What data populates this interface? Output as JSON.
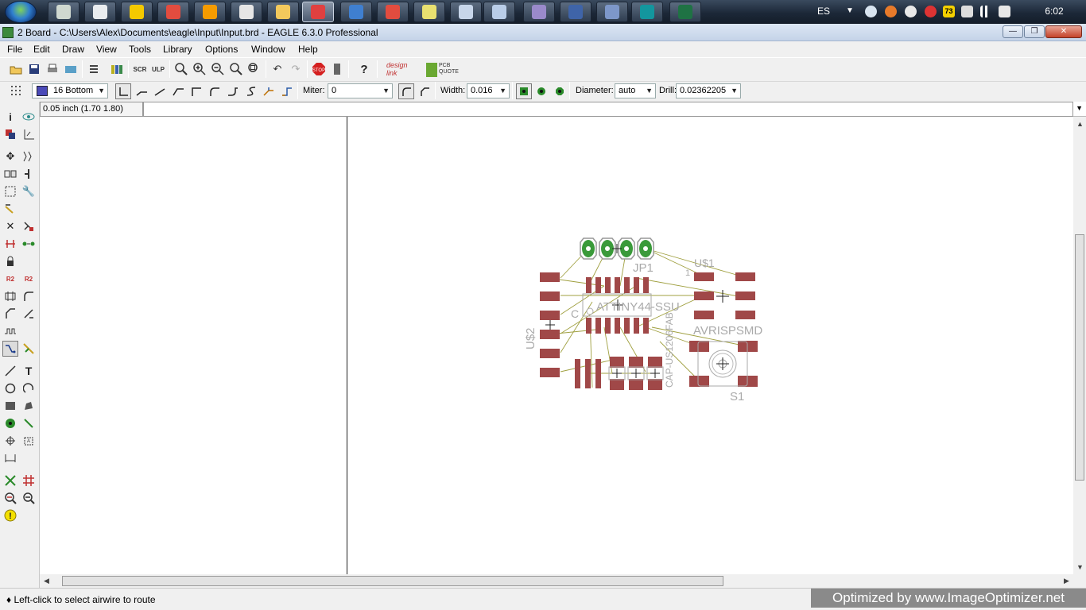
{
  "taskbar": {
    "apps": [
      {
        "name": "app-1",
        "color": "#cfd8d0"
      },
      {
        "name": "calculator",
        "color": "#e9ecef"
      },
      {
        "name": "app-n",
        "color": "#f4c900"
      },
      {
        "name": "chrome",
        "color": "#e24c3f"
      },
      {
        "name": "media-player",
        "color": "#f59b00"
      },
      {
        "name": "app-6",
        "color": "#e6e6e6"
      },
      {
        "name": "explorer",
        "color": "#f3c95c"
      },
      {
        "name": "app-8",
        "color": "#e04040"
      },
      {
        "name": "app-9",
        "color": "#3f7fd0"
      },
      {
        "name": "chrome-2",
        "color": "#e24c3f"
      },
      {
        "name": "app-11",
        "color": "#e8e070"
      },
      {
        "name": "app-12",
        "color": "#c7d6ea"
      },
      {
        "name": "app-13",
        "color": "#b9cde8"
      },
      {
        "name": "app-14",
        "color": "#9a8acb"
      },
      {
        "name": "app-15",
        "color": "#3f64a8"
      },
      {
        "name": "app-16",
        "color": "#7d97c9"
      },
      {
        "name": "arduino",
        "color": "#13969e"
      },
      {
        "name": "excel",
        "color": "#1f7244"
      }
    ],
    "tray": {
      "language": "ES",
      "badge": "73",
      "clock": "6:02"
    }
  },
  "window": {
    "title": "2 Board - C:\\Users\\Alex\\Documents\\eagle\\Input\\Input.brd - EAGLE 6.3.0 Professional",
    "controls": {
      "minimize": "—",
      "maximize": "❐",
      "close": "✕"
    }
  },
  "menu": [
    "File",
    "Edit",
    "Draw",
    "View",
    "Tools",
    "Library",
    "Options",
    "Window",
    "Help"
  ],
  "toolbar2": {
    "layer": "16 Bottom",
    "miter_label": "Miter:",
    "miter_value": "0",
    "width_label": "Width:",
    "width_value": "0.016",
    "diameter_label": "Diameter:",
    "diameter_value": "auto",
    "drill_label": "Drill:",
    "drill_value": "0.02362205"
  },
  "toolbar1": {
    "designlink_label": "design link",
    "pcbquote_label": "PCB QUOTE"
  },
  "command": {
    "coordinates": "0.05 inch (1.70 1.80)",
    "input": ""
  },
  "board": {
    "labels": {
      "jp1": "JP1",
      "u1": "U$1",
      "u2": "U$2",
      "ic": "ATTINY44-SSU",
      "pin1": "1",
      "avrisp": "AVRISPSMD",
      "s1": "S1",
      "cap": "CAP-US1206FAB",
      "c": "C"
    },
    "pad_color": "#a04848",
    "via_color": "#3a9a3a",
    "airwire_color": "#9a9a3a"
  },
  "status": {
    "text": "♦ Left-click to select airwire to route",
    "watermark": "Optimized by www.ImageOptimizer.net"
  }
}
